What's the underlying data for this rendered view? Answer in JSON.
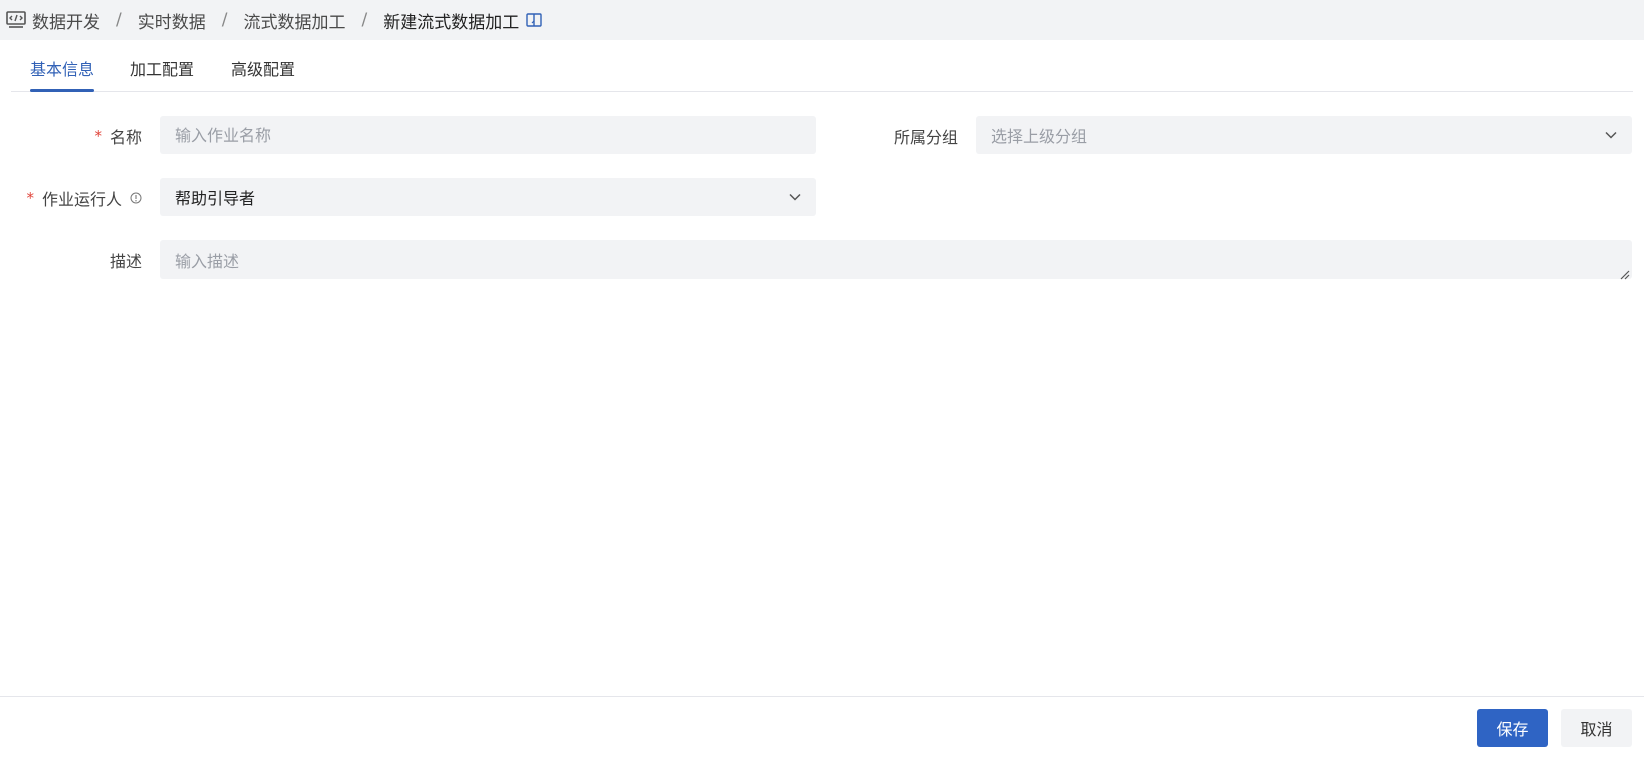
{
  "breadcrumb": {
    "icon": "code-monitor-icon",
    "items": [
      "数据开发",
      "实时数据",
      "流式数据加工"
    ],
    "current": "新建流式数据加工",
    "separator": "/",
    "help_icon": "book-icon"
  },
  "tabs": [
    {
      "label": "基本信息",
      "active": true
    },
    {
      "label": "加工配置",
      "active": false
    },
    {
      "label": "高级配置",
      "active": false
    }
  ],
  "form": {
    "required_mark": "*",
    "name": {
      "label": "名称",
      "placeholder": "输入作业名称",
      "value": ""
    },
    "group": {
      "label": "所属分组",
      "placeholder": "选择上级分组",
      "value": ""
    },
    "runner": {
      "label": "作业运行人",
      "value": "帮助引导者",
      "info_icon": "info-circle-icon"
    },
    "description": {
      "label": "描述",
      "placeholder": "输入描述",
      "value": ""
    }
  },
  "footer": {
    "save_label": "保存",
    "cancel_label": "取消"
  },
  "colors": {
    "accent": "#3161b6",
    "primary_button": "#2f64c4",
    "required": "#e0443a",
    "field_bg": "#f2f3f5"
  }
}
